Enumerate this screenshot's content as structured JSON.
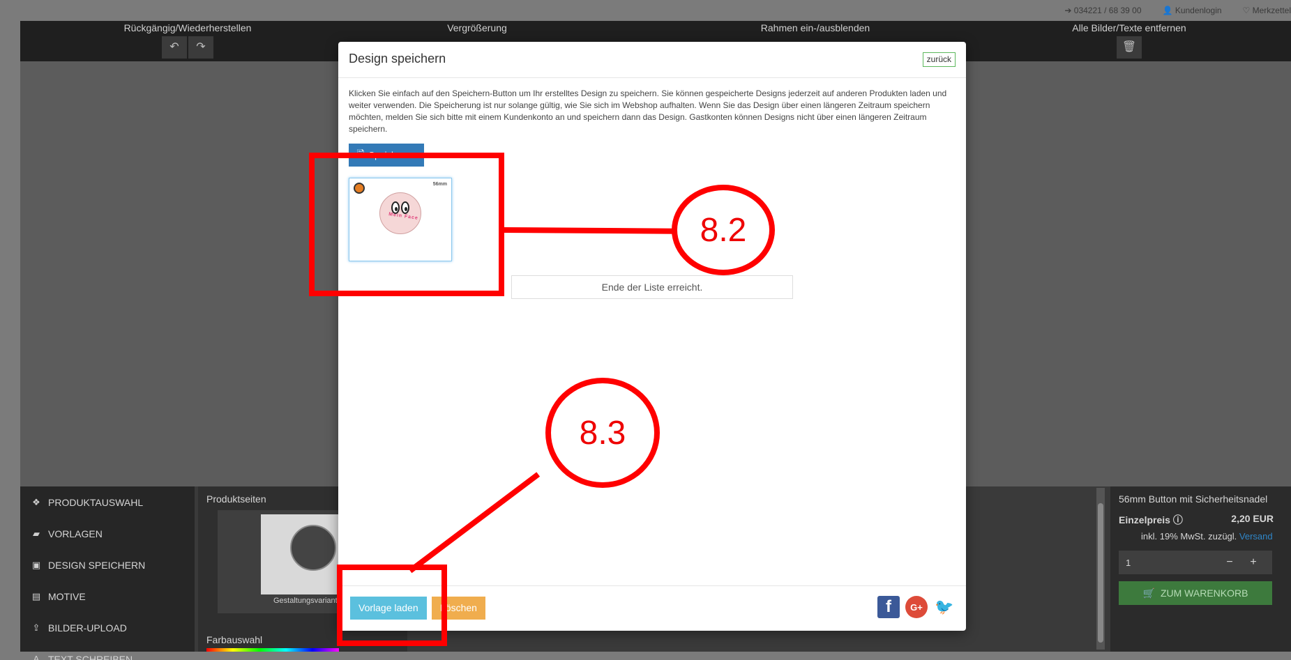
{
  "topbar": {
    "phone": "034221 / 68 39 00",
    "login": "Kundenlogin",
    "wishlist": "Merkzettel"
  },
  "toolbar": {
    "undo_redo": "Rückgängig/Wiederherstellen",
    "zoom": "Vergrößerung",
    "frame_toggle": "Rahmen ein-/ausblenden",
    "remove_all": "Alle Bilder/Texte entfernen"
  },
  "sidebar": {
    "items": [
      {
        "label": "PRODUKTAUSWAHL",
        "icon": "cubes-icon"
      },
      {
        "label": "VORLAGEN",
        "icon": "folder-icon"
      },
      {
        "label": "DESIGN SPEICHERN",
        "icon": "save-icon"
      },
      {
        "label": "MOTIVE",
        "icon": "image-icon"
      },
      {
        "label": "BILDER-UPLOAD",
        "icon": "upload-icon"
      },
      {
        "label": "TEXT SCHREIBEN",
        "icon": "font-icon"
      }
    ]
  },
  "products": {
    "title": "Produktseiten",
    "card_label": "Gestaltungsvariant",
    "color_title": "Farbauswahl"
  },
  "cart": {
    "product": "56mm Button mit Sicherheitsnadel",
    "price_label": "Einzelpreis",
    "price": "2,20 EUR",
    "tax_text": "inkl. 19% MwSt. zuzügl.",
    "shipping_link": "Versand",
    "quantity": "1",
    "add_label": "ZUM WARENKORB"
  },
  "modal": {
    "title": "Design speichern",
    "back_label": "zurück",
    "description": "Klicken Sie einfach auf den Speichern-Button um Ihr erstelltes Design zu speichern. Sie können gespeicherte Designs jederzeit auf anderen Produkten laden und weiter verwenden. Die Speicherung ist nur solange gültig, wie Sie sich im Webshop aufhalten. Wenn Sie das Design über einen längeren Zeitraum speichern möchten, melden Sie sich bitte mit einem Kundenkonto an und speichern dann das Design. Gastkonten können Designs nicht über einen längeren Zeitraum speichern.",
    "save_label": "Speichern",
    "thumb_size": "56mm",
    "thumb_text": "Mein Face",
    "end_of_list": "Ende der Liste erreicht.",
    "load_label": "Vorlage laden",
    "delete_label": "Löschen"
  },
  "annotations": {
    "label_1": "8.2",
    "label_2": "8.3",
    "color": "#ff0000"
  }
}
